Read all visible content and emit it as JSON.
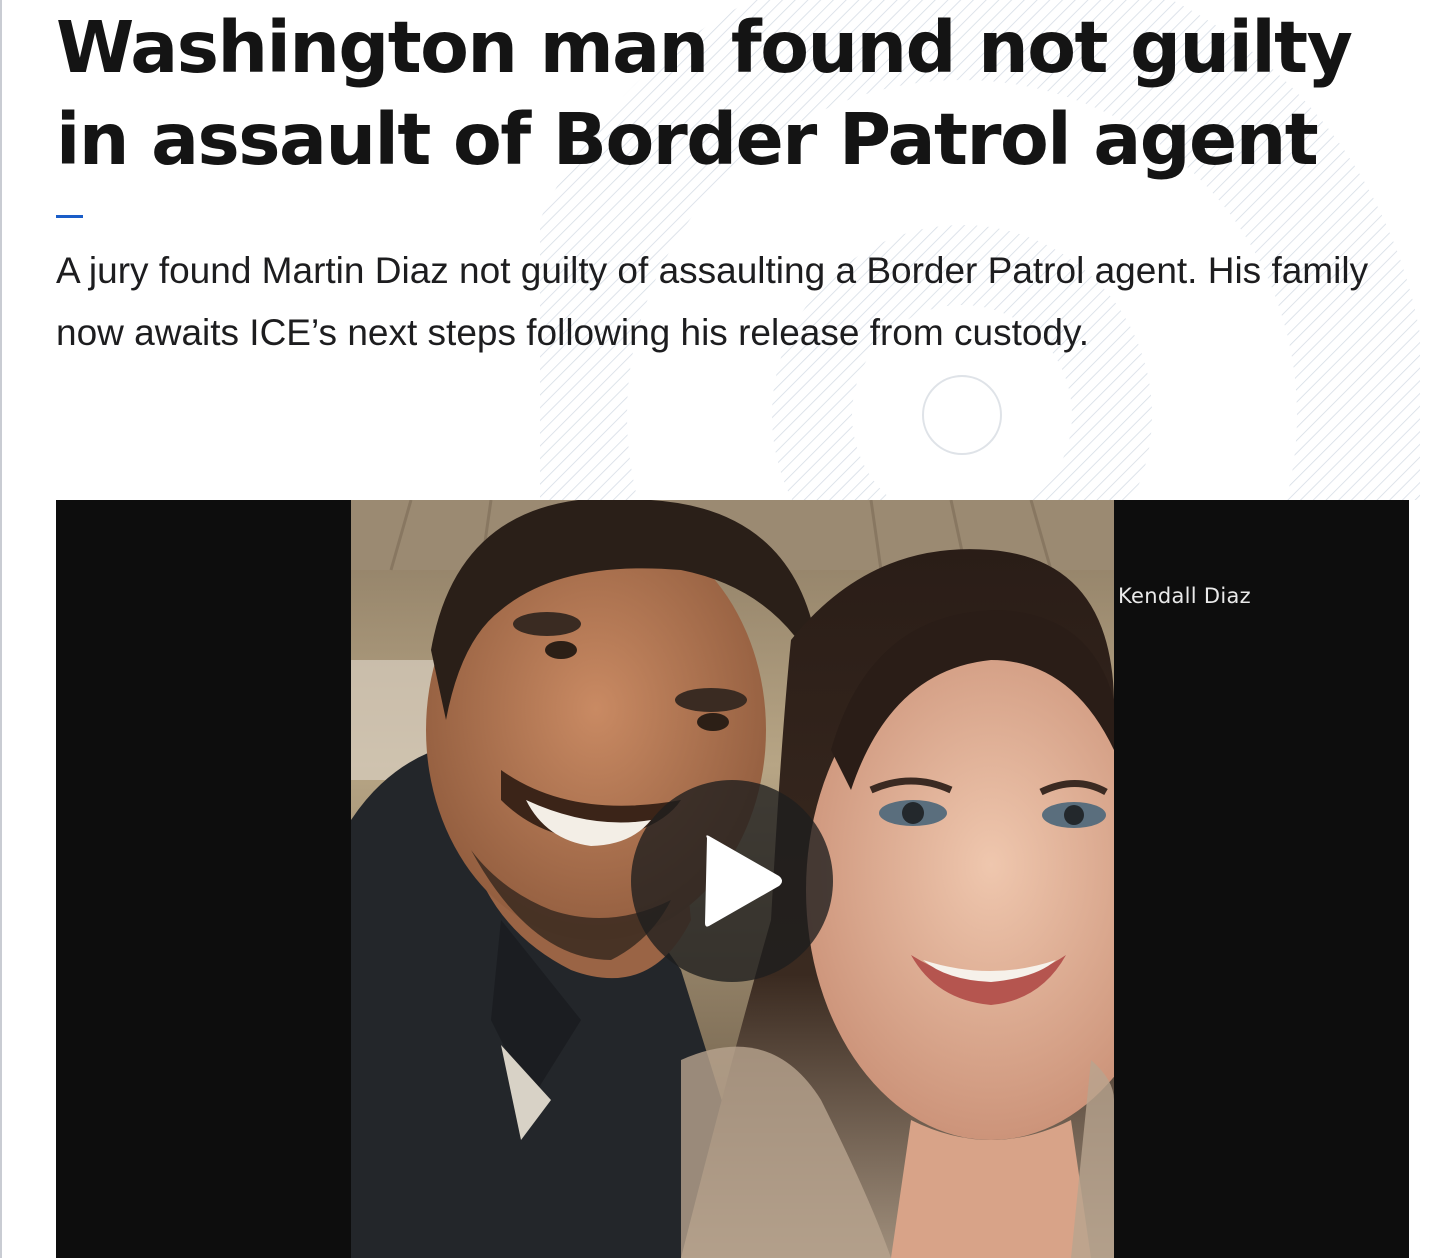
{
  "article": {
    "headline": "Washington man found not guilty in assault of Border Patrol agent",
    "dek": "A jury found Martin Diaz not guilty of assaulting a Border Patrol agent. His family now awaits ICE’s next steps following his release from custody."
  },
  "video": {
    "photo_credit": "Kendall Diaz",
    "play_icon": "play-icon"
  },
  "colors": {
    "accent": "#1a5dc8",
    "headline": "#141414",
    "video_background": "#0d0d0d"
  }
}
